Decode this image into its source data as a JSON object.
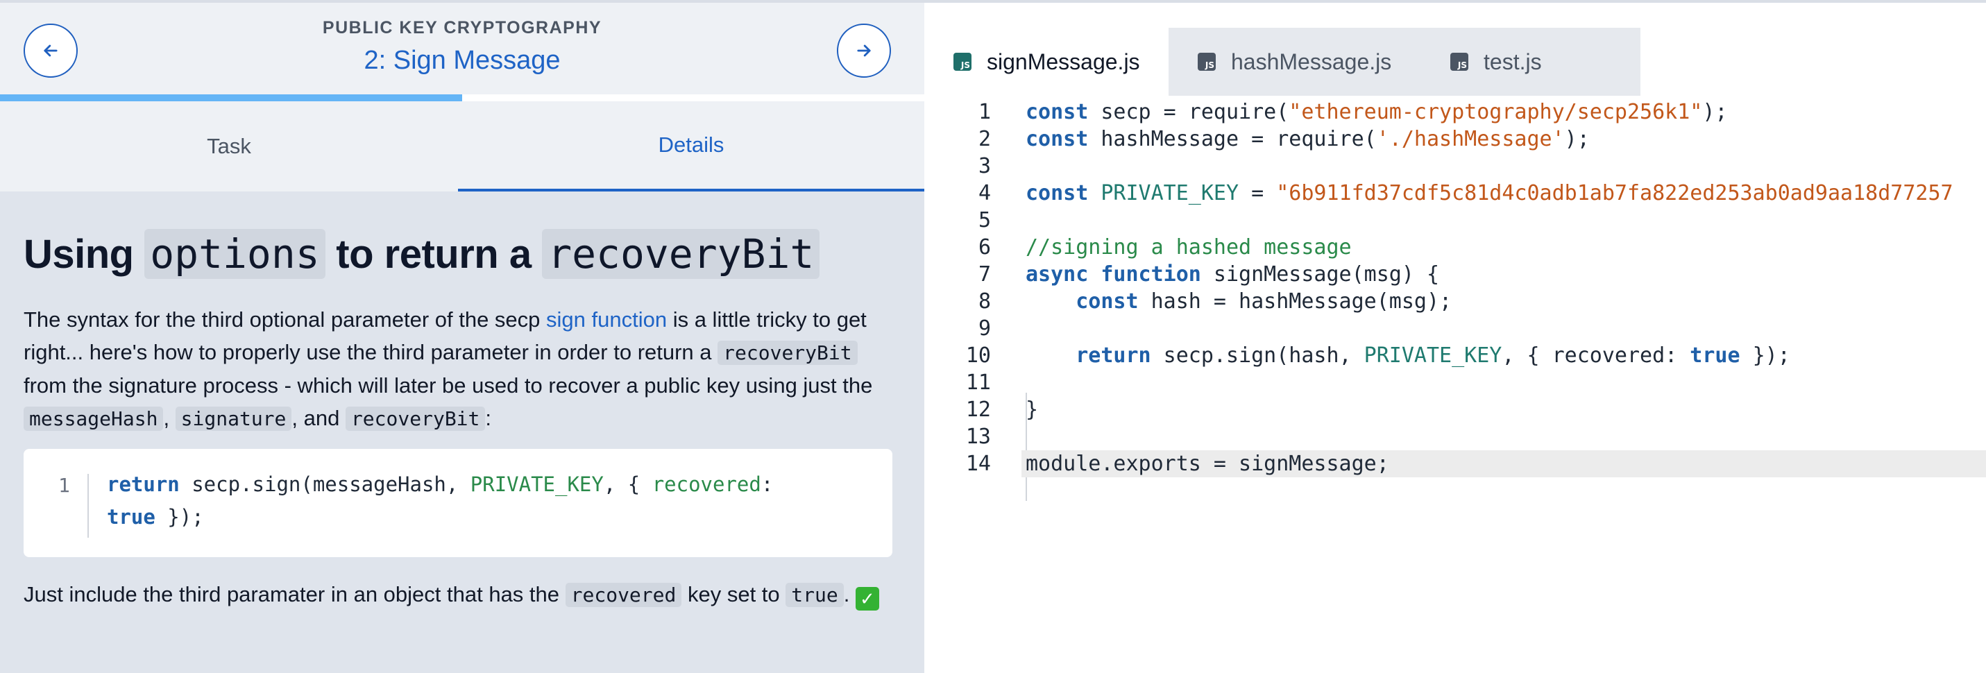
{
  "course": {
    "title": "PUBLIC KEY CRYPTOGRAPHY",
    "lesson": "2: Sign Message",
    "progress": 0.5
  },
  "nav": {
    "prev_icon": "arrow-left-icon",
    "next_icon": "arrow-right-icon"
  },
  "tabs": {
    "task": "Task",
    "details": "Details"
  },
  "details": {
    "heading_pre": "Using ",
    "heading_code1": "options",
    "heading_mid": " to return a ",
    "heading_code2": "recoveryBit",
    "p1_a": "The syntax for the third optional parameter of the secp ",
    "p1_link": "sign function",
    "p1_b": " is a little tricky to get right... here's how to properly use the third parameter in order to return a ",
    "p1_code1": "recoveryBit",
    "p1_c": " from the signature process - which will later be used to recover a public key using just the ",
    "p1_code2": "messageHash",
    "p1_d": ", ",
    "p1_code3": "signature",
    "p1_e": ", and ",
    "p1_code4": "recoveryBit",
    "p1_f": ":",
    "snippet_line": "1",
    "snippet_return": "return",
    "snippet_a": " secp.sign(messageHash, ",
    "snippet_const": "PRIVATE_KEY",
    "snippet_b": ", { ",
    "snippet_key": "recovered",
    "snippet_c": ":",
    "snippet_true": "true",
    "snippet_d": " });",
    "p2_a": "Just include the third paramater in an object that has the ",
    "p2_code1": "recovered",
    "p2_b": " key set to ",
    "p2_code2": "true",
    "p2_c": ". ",
    "p2_check": "✓"
  },
  "files": [
    {
      "name": "signMessage.js",
      "active": true
    },
    {
      "name": "hashMessage.js",
      "active": false
    },
    {
      "name": "test.js",
      "active": false
    }
  ],
  "file_icon_label": "JS",
  "code": {
    "line_numbers": [
      "1",
      "2",
      "3",
      "4",
      "5",
      "6",
      "7",
      "8",
      "9",
      "10",
      "11",
      "12",
      "13",
      "14"
    ],
    "l1_kw": "const",
    "l1_a": " secp = require(",
    "l1_str": "\"ethereum-cryptography/secp256k1\"",
    "l1_b": ");",
    "l2_kw": "const",
    "l2_a": " hashMessage = require(",
    "l2_str": "'./hashMessage'",
    "l2_b": ");",
    "l4_kw": "const",
    "l4_const": " PRIVATE_KEY",
    "l4_a": " = ",
    "l4_str": "\"6b911fd37cdf5c81d4c0adb1ab7fa822ed253ab0ad9aa18d77257",
    "l6_cm": "//signing a hashed message",
    "l7_kw": "async function",
    "l7_a": " signMessage(msg) {",
    "l8_kw": "const",
    "l8_a": " hash = hashMessage(msg);",
    "l10_kw": "return",
    "l10_a": " secp.sign(hash, ",
    "l10_const": "PRIVATE_KEY",
    "l10_b": ", { recovered: ",
    "l10_true": "true",
    "l10_c": " });",
    "l12": "}",
    "l14": "module.exports = signMessage;"
  }
}
